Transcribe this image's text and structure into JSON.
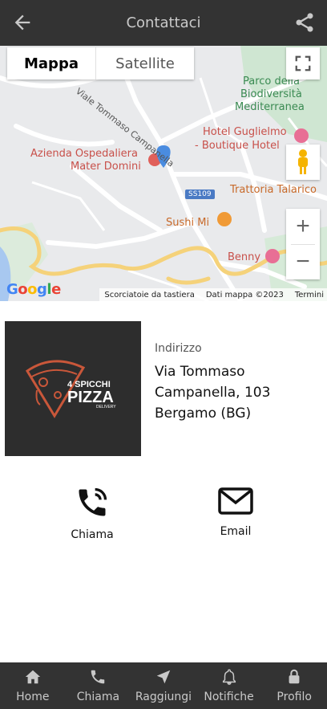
{
  "header": {
    "title": "Contattaci"
  },
  "map": {
    "map_type_labels": {
      "map": "Mappa",
      "satellite": "Satellite"
    },
    "place_labels": {
      "street": "Viale Tommaso Campanella",
      "hospital": "Azienda Ospedaliera Mater Domini",
      "hotel": "Hotel Guglielmo - Boutique Hotel",
      "park": "Parco della Biodiversità Mediterranea",
      "trattoria": "Trattoria Talarico",
      "sushi": "Sushi Mi",
      "benny": "Benny",
      "road_badge": "SS109"
    },
    "hospital_lines": [
      "Azienda Ospedaliera",
      "Mater Domini"
    ],
    "hotel_lines": [
      "Hotel Guglielmo",
      "- Boutique Hotel"
    ],
    "park_lines": [
      "Parco della",
      "Biodiversità",
      "Mediterranea"
    ],
    "google_logo": "Google",
    "attribution": {
      "shortcuts": "Scorciatoie da tastiera",
      "map_data": "Dati mappa ©2023",
      "terms": "Termini"
    },
    "zoom_in": "+",
    "zoom_out": "−"
  },
  "business": {
    "logo_text": {
      "line1": "4 SPICCHI",
      "line2": "PIZZA",
      "line3": "DELIVERY"
    },
    "address_label": "Indirizzo",
    "address_lines": [
      "Via Tommaso",
      "Campanella, 103",
      "Bergamo (BG)"
    ]
  },
  "actions": {
    "call_label": "Chiama",
    "email_label": "Email"
  },
  "bottom_nav": [
    {
      "label": "Home",
      "icon": "home-icon"
    },
    {
      "label": "Chiama",
      "icon": "phone-icon"
    },
    {
      "label": "Raggiungi",
      "icon": "navigation-arrow-icon"
    },
    {
      "label": "Notifiche",
      "icon": "bell-icon"
    },
    {
      "label": "Profilo",
      "icon": "lock-icon"
    }
  ],
  "colors": {
    "bar": "#333333",
    "bar_text": "#c9c9c9",
    "marker": "#4a8ce0"
  }
}
